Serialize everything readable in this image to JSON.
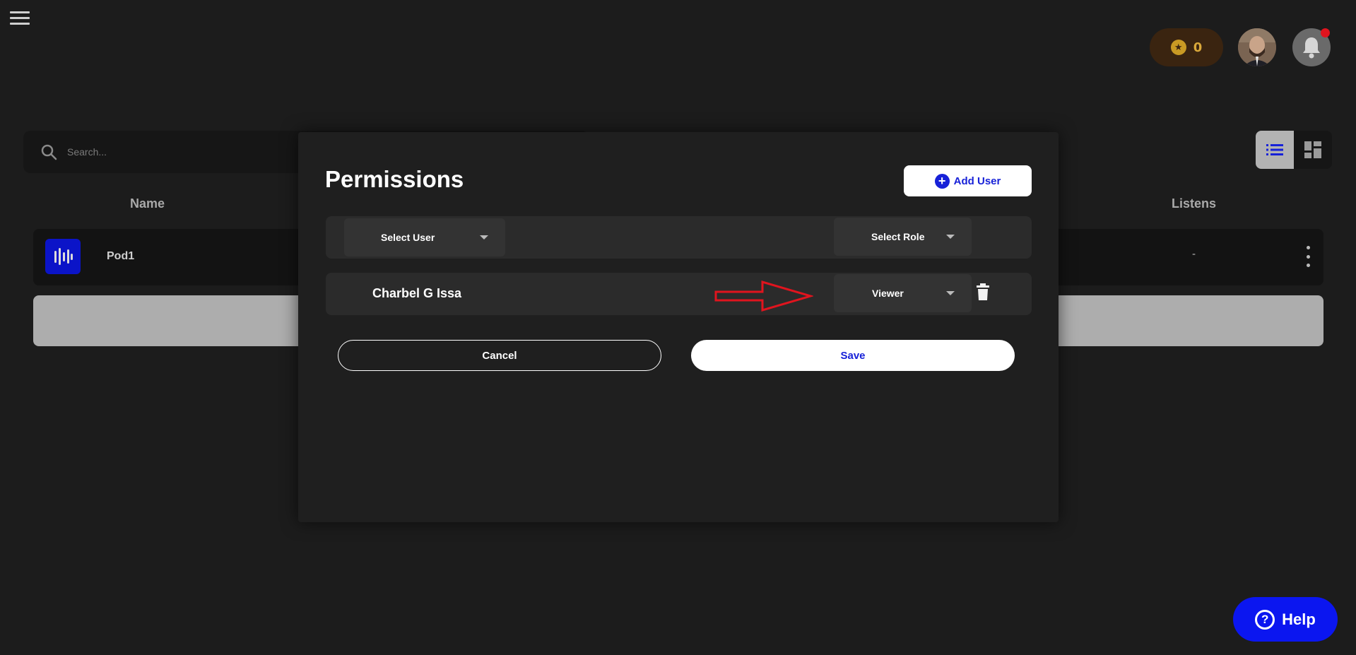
{
  "header": {
    "coins": "0"
  },
  "search": {
    "placeholder": "Search..."
  },
  "table": {
    "columns": {
      "name": "Name",
      "listens": "Listens"
    },
    "rows": [
      {
        "name": "Pod1",
        "listens": "-"
      }
    ]
  },
  "modal": {
    "title": "Permissions",
    "add_user_label": "Add User",
    "select_user_label": "Select User",
    "select_role_label": "Select Role",
    "users": [
      {
        "name": "Charbel G Issa",
        "role": "Viewer"
      }
    ],
    "cancel_label": "Cancel",
    "save_label": "Save"
  },
  "help": {
    "label": "Help"
  },
  "colors": {
    "accent": "#1721d8",
    "help_button": "#0b16f0",
    "annotation_arrow": "#e0141e",
    "background": "#1c1c1c"
  },
  "icons": {
    "menu": "hamburger-menu-icon",
    "coin": "star-coin-icon",
    "notification": "bell-icon",
    "search": "search-icon",
    "list_view": "list-view-icon",
    "grid_view": "grid-view-icon",
    "pod": "waveform-icon",
    "more": "kebab-menu-icon",
    "add": "plus-circle-icon",
    "delete": "trash-icon",
    "help": "question-circle-icon",
    "annotation": "red-arrow-annotation"
  }
}
